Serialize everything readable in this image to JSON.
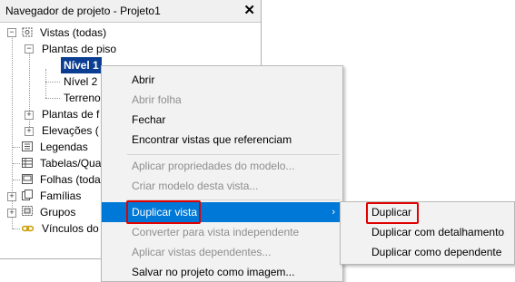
{
  "panel": {
    "title": "Navegador de projeto - Projeto1",
    "close": "✕"
  },
  "tree": {
    "views": "Vistas (todas)",
    "floor_plans": "Plantas de piso",
    "level1": "Nível 1",
    "level2": "Nível 2",
    "terrain": "Terreno",
    "ceiling_plans": "Plantas de f",
    "elevations": "Elevações (",
    "legends": "Legendas",
    "schedules": "Tabelas/Qua",
    "sheets": "Folhas (toda",
    "families": "Famílias",
    "groups": "Grupos",
    "links": "Vínculos do"
  },
  "menu": {
    "open": "Abrir",
    "open_sheet": "Abrir folha",
    "close": "Fechar",
    "find_views": "Encontrar vistas que referenciam",
    "apply_props": "Aplicar propriedades do modelo...",
    "create_template": "Criar modelo desta vista...",
    "duplicate_view": "Duplicar vista",
    "convert_independent": "Converter para vista independente",
    "apply_dependents": "Aplicar vistas dependentes...",
    "save_image": "Salvar no projeto como imagem...",
    "submenu_arrow": "›"
  },
  "submenu": {
    "duplicate": "Duplicar",
    "duplicate_detail": "Duplicar com detalhamento",
    "duplicate_dependent": "Duplicar como dependente"
  },
  "colors": {
    "highlight": "#0078d7",
    "selection": "#0b3e92",
    "annotation": "#e00000"
  }
}
